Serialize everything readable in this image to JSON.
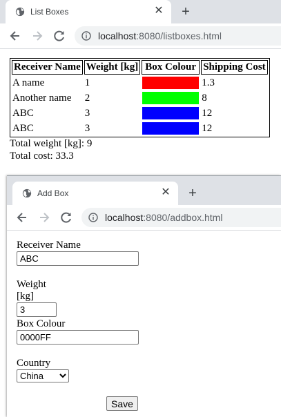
{
  "window1": {
    "tab_title": "List Boxes",
    "close_glyph": "✕",
    "newtab_glyph": "+",
    "url_host": "localhost",
    "url_path": ":8080/listboxes.html",
    "table": {
      "headers": [
        "Receiver Name",
        "Weight [kg]",
        "Box Colour",
        "Shipping Cost"
      ],
      "rows": [
        {
          "name": "A name",
          "weight": "1",
          "colour": "#ff0000",
          "cost": "1.3"
        },
        {
          "name": "Another name",
          "weight": "2",
          "colour": "#00ff00",
          "cost": "8"
        },
        {
          "name": "ABC",
          "weight": "3",
          "colour": "#0000ff",
          "cost": "12"
        },
        {
          "name": "ABC",
          "weight": "3",
          "colour": "#0000ff",
          "cost": "12"
        }
      ]
    },
    "total_weight": "Total weight [kg]: 9",
    "total_cost": "Total cost: 33.3"
  },
  "window2": {
    "tab_title": "Add Box",
    "close_glyph": "✕",
    "newtab_glyph": "+",
    "url_host": "localhost",
    "url_path": ":8080/addbox.html",
    "form": {
      "receiver_label": "Receiver Name",
      "receiver_value": "ABC",
      "weight_label": "Weight [kg]",
      "weight_value": "3",
      "colour_label": "Box Colour",
      "colour_value": "0000FF",
      "country_label": "Country",
      "country_value": "China",
      "save_label": "Save"
    }
  },
  "colors": {
    "tabstrip": "#dee1e6",
    "omnibox": "#f1f3f4",
    "icon": "#5f6368"
  }
}
